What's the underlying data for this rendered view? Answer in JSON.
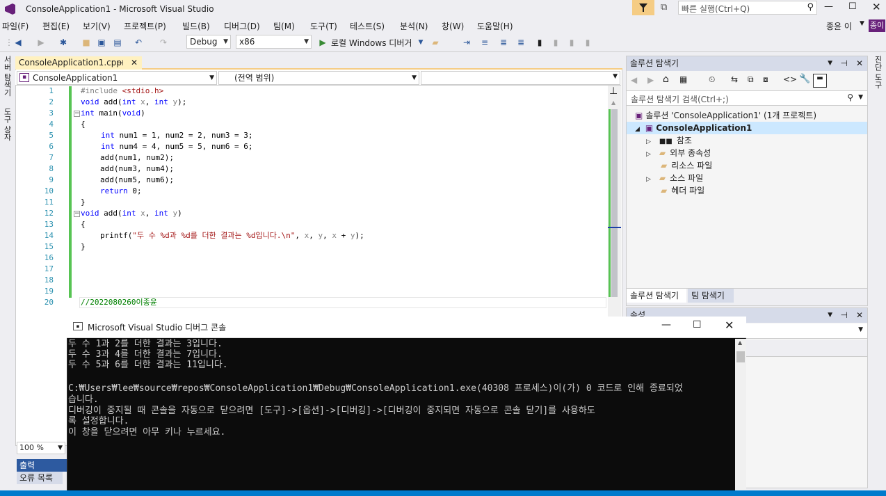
{
  "window": {
    "title": "ConsoleApplication1 - Microsoft Visual Studio",
    "quick_launch_placeholder": "빠른 실행(Ctrl+Q)"
  },
  "menu": [
    "파일(F)",
    "편집(E)",
    "보기(V)",
    "프로젝트(P)",
    "빌드(B)",
    "디버그(D)",
    "팀(M)",
    "도구(T)",
    "테스트(S)",
    "분석(N)",
    "창(W)",
    "도움말(H)"
  ],
  "user": {
    "name": "종윤 이",
    "avatar": "종이"
  },
  "toolbar": {
    "config": "Debug",
    "platform": "x86",
    "run_label": "로컬 Windows 디버거"
  },
  "left_strip": {
    "server_explorer": "서버 탐색기",
    "toolbox": "도구 상자"
  },
  "right_strip": {
    "label": "진단 도구"
  },
  "editor": {
    "tab_label": "ConsoleApplication1.cpp",
    "nav_project": "ConsoleApplication1",
    "nav_scope": "(전역 범위)",
    "zoom": "100 %",
    "line_numbers": [
      "1",
      "2",
      "3",
      "4",
      "5",
      "6",
      "7",
      "8",
      "9",
      "10",
      "11",
      "12",
      "13",
      "14",
      "15",
      "16",
      "17",
      "18",
      "19",
      "20"
    ],
    "lines": [
      {
        "pp": "#include ",
        "inc": "<stdio.h>"
      },
      {
        "kw": "void",
        "t1": " add(",
        "kw2": "int",
        "p1": " x",
        "t2": ", ",
        "kw3": "int",
        "p2": " y",
        "t3": ");"
      },
      {
        "kw": "int",
        "t1": " main(",
        "kw2": "void",
        "t2": ")"
      },
      {
        "t": "{"
      },
      {
        "kw": "int",
        "t": " num1 = 1, num2 = 2, num3 = 3;"
      },
      {
        "kw": "int",
        "t": " num4 = 4, num5 = 5, num6 = 6;"
      },
      {
        "t": "add(num1, num2);"
      },
      {
        "t": "add(num3, num4);"
      },
      {
        "t": "add(num5, num6);"
      },
      {
        "kw": "return",
        "t": " 0;"
      },
      {
        "t": "}"
      },
      {
        "kw": "void",
        "t1": " add(",
        "kw2": "int",
        "p1": " x",
        "t2": ", ",
        "kw3": "int",
        "p2": " y",
        "t3": ")"
      },
      {
        "t": "{"
      },
      {
        "t1": "printf(",
        "str": "\"두 수 %d과 %d를 더한 결과는 %d입니다.\\n\"",
        "t2": ", ",
        "p1": "x",
        "t3": ", ",
        "p2": "y",
        "t4": ", ",
        "p3": "x",
        "t5": " + ",
        "p4": "y",
        "t6": ");"
      },
      {
        "t": "}"
      },
      {
        "t": ""
      },
      {
        "t": ""
      },
      {
        "t": ""
      },
      {
        "t": ""
      },
      {
        "cmt": "//2022080260이종윤"
      }
    ]
  },
  "output": {
    "tab1": "출력",
    "tab2": "오류 목록"
  },
  "solution_explorer": {
    "title": "솔루션 탐색기",
    "search_placeholder": "솔루션 탐색기 검색(Ctrl+;)",
    "solution": "솔루션 'ConsoleApplication1' (1개 프로젝트)",
    "project": "ConsoleApplication1",
    "nodes": [
      "참조",
      "외부 종속성",
      "리소스 파일",
      "소스 파일",
      "헤더 파일"
    ],
    "bottom_tabs": [
      "솔루션 탐색기",
      "팀 탐색기"
    ]
  },
  "properties": {
    "title": "속성"
  },
  "console": {
    "title": "Microsoft Visual Studio 디버그 콘솔",
    "lines": [
      "두 수 1과 2를 더한 결과는 3입니다.",
      "두 수 3과 4를 더한 결과는 7입니다.",
      "두 수 5과 6를 더한 결과는 11입니다.",
      "",
      "C:₩Users₩lee₩source₩repos₩ConsoleApplication1₩Debug₩ConsoleApplication1.exe(40308 프로세스)이(가) 0 코드로 인해 종료되었",
      "습니다.",
      "디버깅이 중지될 때 콘솔을 자동으로 닫으려면 [도구]->[옵션]->[디버깅]->[디버깅이 중지되면 자동으로 콘솔 닫기]를 사용하도",
      "록 설정합니다.",
      "이 창을 닫으려면 아무 키나 누르세요."
    ]
  },
  "colors": {
    "accent": "#007acc",
    "vs_purple": "#68217a",
    "filetab": "#fff1c0",
    "green_margin": "#57c453"
  }
}
